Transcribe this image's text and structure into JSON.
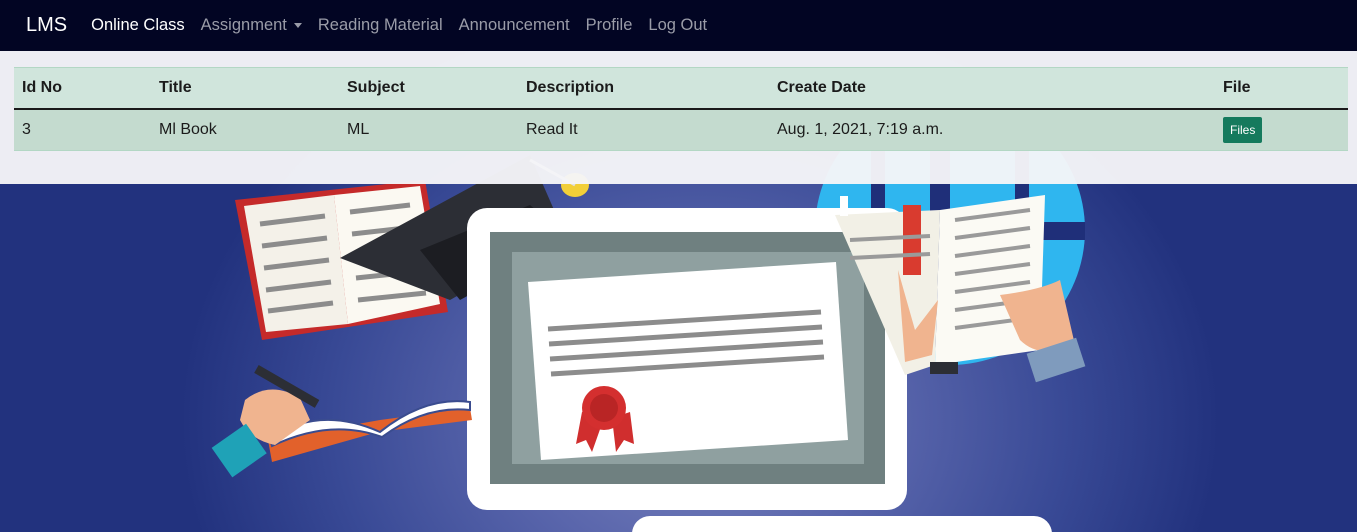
{
  "navbar": {
    "brand": "LMS",
    "items": [
      {
        "label": "Online Class",
        "active": true
      },
      {
        "label": "Assignment",
        "dropdown": true
      },
      {
        "label": "Reading Material"
      },
      {
        "label": "Announcement"
      },
      {
        "label": "Profile"
      },
      {
        "label": "Log Out"
      }
    ]
  },
  "table": {
    "headers": [
      "Id No",
      "Title",
      "Subject",
      "Description",
      "Create Date",
      "File"
    ],
    "rows": [
      {
        "id": "3",
        "title": "Ml Book",
        "subject": "ML",
        "description": "Read It",
        "create_date": "Aug. 1, 2021, 7:19 a.m.",
        "file_button": "Files"
      }
    ]
  },
  "colors": {
    "navbar_bg": "#020523",
    "table_header_bg": "#d0e5dc",
    "table_row_bg": "#c4dbcf",
    "files_button": "#157a5d",
    "background": "#24357f"
  },
  "icons": [
    "graduation-cap-icon",
    "certificate-icon",
    "open-book-icon",
    "globe-icon",
    "pen-icon",
    "award-ribbon-icon"
  ]
}
